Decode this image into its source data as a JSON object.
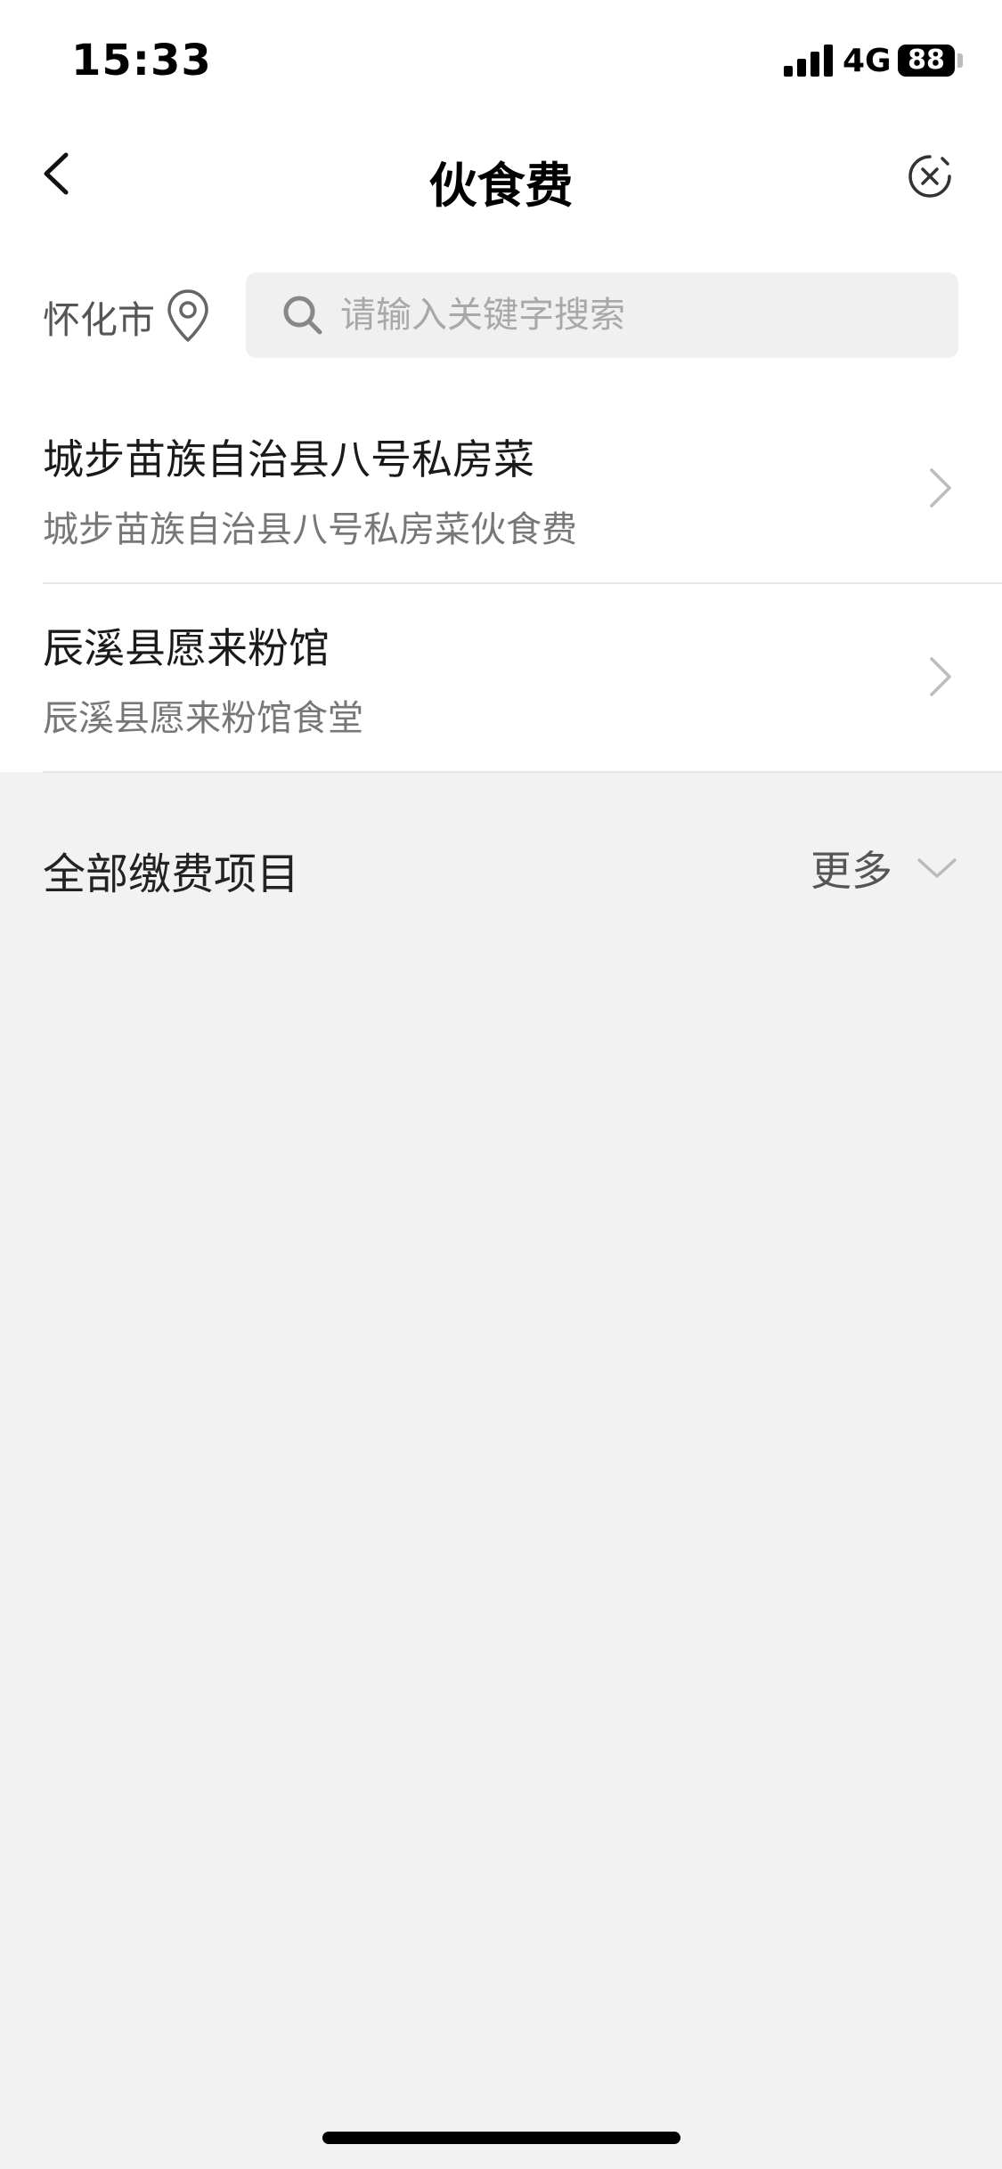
{
  "status_bar": {
    "time": "15:33",
    "network": "4G",
    "battery": "88"
  },
  "nav": {
    "title": "伙食费"
  },
  "filter": {
    "city": "怀化市",
    "search_placeholder": "请输入关键字搜索"
  },
  "merchants": [
    {
      "title": "城步苗族自治县八号私房菜",
      "subtitle": "城步苗族自治县八号私房菜伙食费"
    },
    {
      "title": "辰溪县愿来粉馆",
      "subtitle": "辰溪县愿来粉馆食堂"
    }
  ],
  "all_items": {
    "title": "全部缴费项目",
    "more_label": "更多"
  },
  "icons": {
    "back": "chevron-left-icon",
    "close": "close-circle-icon",
    "location": "location-pin-icon",
    "search": "search-icon",
    "item_arrow": "chevron-right-icon",
    "expand": "chevron-down-icon"
  }
}
